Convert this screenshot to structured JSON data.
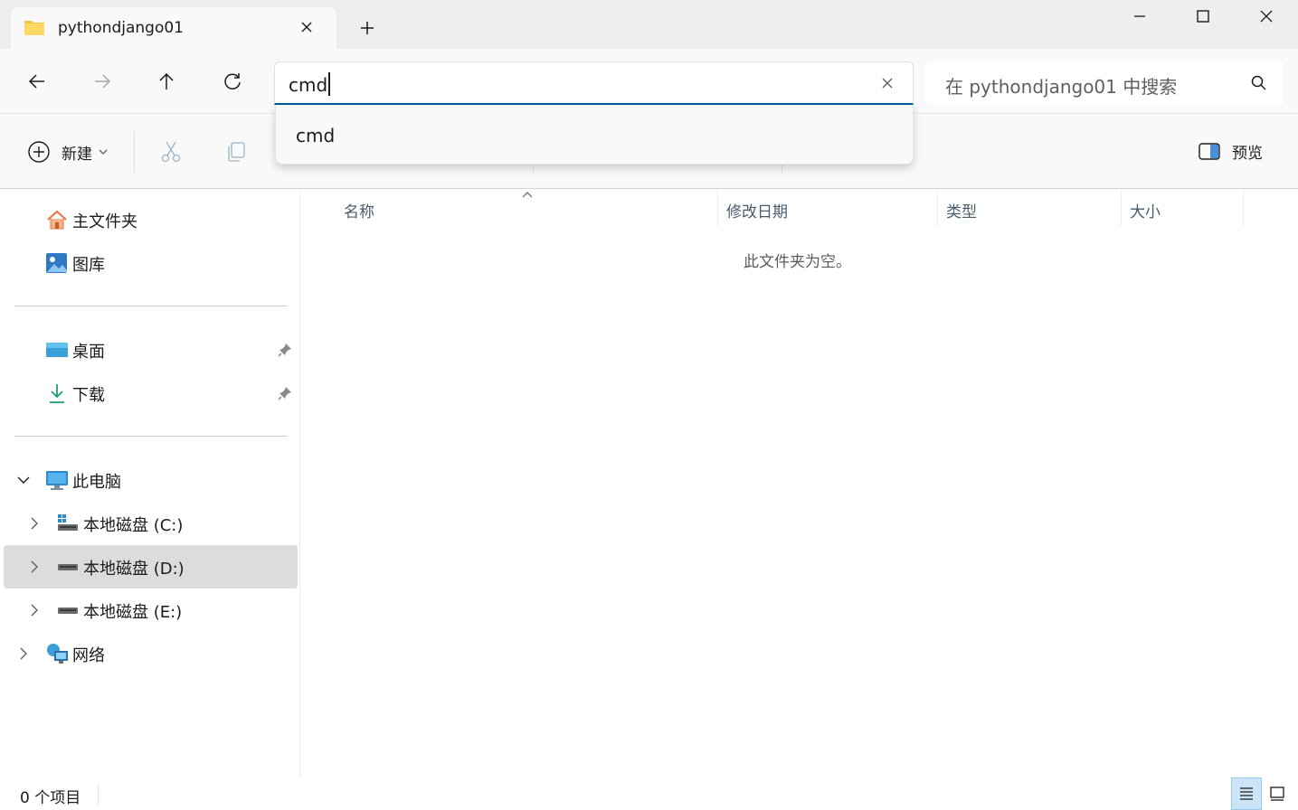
{
  "tab": {
    "title": "pythondjango01"
  },
  "address": {
    "value": "cmd"
  },
  "search": {
    "placeholder": "在 pythondjango01 中搜索"
  },
  "dropdown": {
    "items": [
      "cmd"
    ]
  },
  "toolbar": {
    "new_label": "新建",
    "preview_label": "预览"
  },
  "sidebar": {
    "quick": [
      {
        "label": "主文件夹",
        "icon": "home-icon"
      },
      {
        "label": "图库",
        "icon": "gallery-icon"
      }
    ],
    "pinned": [
      {
        "label": "桌面",
        "icon": "desktop-icon"
      },
      {
        "label": "下载",
        "icon": "download-icon"
      }
    ],
    "this_pc": "此电脑",
    "drives": [
      {
        "label": "本地磁盘 (C:)"
      },
      {
        "label": "本地磁盘 (D:)"
      },
      {
        "label": "本地磁盘 (E:)"
      }
    ],
    "network": "网络"
  },
  "columns": {
    "name": "名称",
    "date": "修改日期",
    "type": "类型",
    "size": "大小"
  },
  "content": {
    "empty_message": "此文件夹为空。"
  },
  "status": {
    "item_count": "0 个项目"
  },
  "colors": {
    "accent": "#005a9e",
    "selected": "#dcdcdc",
    "view_active": "#cce4f7"
  }
}
